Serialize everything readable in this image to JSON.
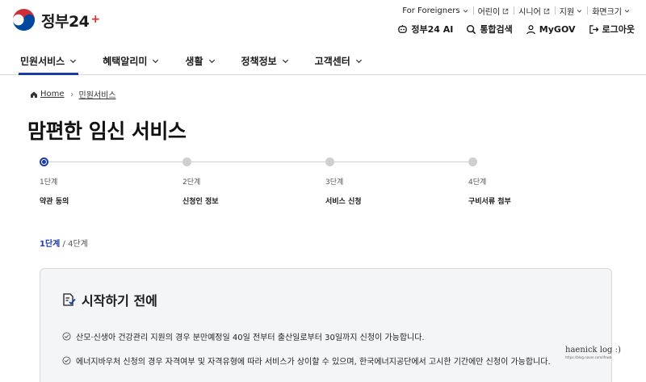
{
  "header": {
    "logo_text": "정부24",
    "logo_plus": "+",
    "util_links": [
      {
        "label": "For Foreigners",
        "icon": "chevron-down-icon"
      },
      {
        "label": "어린이",
        "icon": "external-link-icon"
      },
      {
        "label": "시니어",
        "icon": "external-link-icon"
      },
      {
        "label": "지원",
        "icon": "chevron-down-icon"
      },
      {
        "label": "화면크기",
        "icon": "chevron-down-icon"
      }
    ],
    "actions": [
      {
        "label": "정부24 AI",
        "icon": "ai-icon"
      },
      {
        "label": "통합검색",
        "icon": "search-icon"
      },
      {
        "label": "MyGOV",
        "icon": "user-icon"
      },
      {
        "label": "로그아웃",
        "icon": "logout-icon"
      }
    ]
  },
  "nav": {
    "items": [
      {
        "label": "민원서비스",
        "active": true
      },
      {
        "label": "혜택알리미"
      },
      {
        "label": "생활"
      },
      {
        "label": "정책정보"
      },
      {
        "label": "고객센터"
      }
    ]
  },
  "breadcrumb": {
    "home": "Home",
    "current": "민원서비스"
  },
  "page": {
    "title": "맘편한 임신 서비스"
  },
  "stepper": {
    "steps": [
      {
        "num": "1단계",
        "label": "약관 동의"
      },
      {
        "num": "2단계",
        "label": "신청인 정보"
      },
      {
        "num": "3단계",
        "label": "서비스 신청"
      },
      {
        "num": "4단계",
        "label": "구비서류 첨부"
      }
    ],
    "current_step": 1
  },
  "progress": {
    "current": "1단계",
    "separator": "/",
    "total": "4단계"
  },
  "info": {
    "title": "시작하기 전에",
    "items": [
      "산모·신생아 건강관리 지원의 경우 분만예정일 40일 전부터 출산일로부터 30일까지 신청이 가능합니다.",
      "에너지바우처 신청의 경우 자격여부 및 자격유형에 따라 서비스가 상이할 수 있으며, 한국에너지공단에서 고시한 기간에만 신청이 가능합니다."
    ]
  },
  "watermark": {
    "main": "haenick log :)",
    "sub": "https://blog.naver.com/ifnwb"
  },
  "colors": {
    "accent": "#1c3aa9",
    "logo_red": "#e02a2a",
    "panel_bg": "#f4f5f6"
  }
}
